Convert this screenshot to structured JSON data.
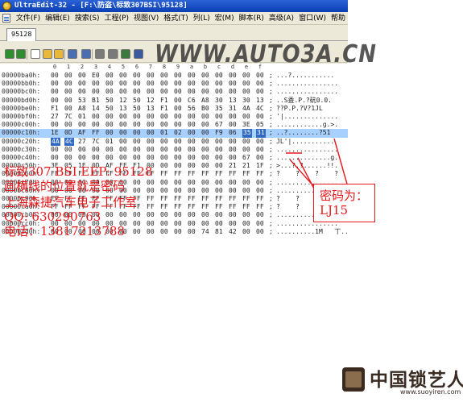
{
  "window": {
    "title": "UltraEdit-32 - [F:\\防盗\\标致307BSI\\95128]",
    "menu": [
      "文件(F)",
      "编辑(E)",
      "搜索(S)",
      "工程(P)",
      "视图(V)",
      "格式(T)",
      "列(L)",
      "宏(M)",
      "脚本(R)",
      "高级(A)",
      "窗口(W)",
      "帮助"
    ],
    "tab": "95128",
    "toolbar_icons": [
      "arrow-left-icon",
      "arrow-right-icon",
      "new-file-icon",
      "open-folder-icon",
      "open-folder-icon",
      "save-icon",
      "save-all-icon",
      "print-icon",
      "print-preview-icon",
      "hex-view-icon",
      "spell-check-icon"
    ]
  },
  "watermark": "WWW.AUTO3A.CN",
  "editor": {
    "ruler": [
      "0",
      "1",
      "2",
      "3",
      "4",
      "5",
      "6",
      "7",
      "8",
      "9",
      "a",
      "b",
      "c",
      "d",
      "e",
      "f"
    ],
    "rows": [
      {
        "addr": "00000ba0h:",
        "hex": [
          "00",
          "00",
          "00",
          "E0",
          "00",
          "00",
          "00",
          "00",
          "00",
          "00",
          "00",
          "00",
          "00",
          "00",
          "00",
          "00"
        ],
        "ascii": "...?..........."
      },
      {
        "addr": "00000bb0h:",
        "hex": [
          "00",
          "00",
          "00",
          "00",
          "00",
          "00",
          "00",
          "00",
          "00",
          "00",
          "00",
          "00",
          "00",
          "00",
          "00",
          "00"
        ],
        "ascii": "................"
      },
      {
        "addr": "00000bc0h:",
        "hex": [
          "00",
          "00",
          "00",
          "00",
          "00",
          "00",
          "00",
          "00",
          "00",
          "00",
          "00",
          "00",
          "00",
          "00",
          "00",
          "00"
        ],
        "ascii": "................"
      },
      {
        "addr": "00000bd0h:",
        "hex": [
          "00",
          "00",
          "53",
          "B1",
          "50",
          "12",
          "50",
          "12",
          "F1",
          "00",
          "C6",
          "A8",
          "30",
          "13",
          "30",
          "13"
        ],
        "ascii": "..S盉.P.?砊0.0."
      },
      {
        "addr": "00000be0h:",
        "hex": [
          "F1",
          "00",
          "A8",
          "14",
          "50",
          "13",
          "50",
          "13",
          "F1",
          "00",
          "56",
          "B0",
          "35",
          "31",
          "4A",
          "4C"
        ],
        "ascii": "??P.P.?V?1JL"
      },
      {
        "addr": "00000bf0h:",
        "hex": [
          "27",
          "7C",
          "01",
          "00",
          "00",
          "00",
          "00",
          "00",
          "00",
          "00",
          "00",
          "00",
          "00",
          "00",
          "00",
          "00"
        ],
        "ascii": "'|.............."
      },
      {
        "addr": "00000c00h:",
        "hex": [
          "00",
          "00",
          "00",
          "00",
          "00",
          "00",
          "00",
          "00",
          "00",
          "00",
          "00",
          "00",
          "67",
          "00",
          "3E",
          "05"
        ],
        "ascii": "............g.>."
      },
      {
        "addr": "00000c10h:",
        "hex": [
          "1E",
          "0D",
          "AF",
          "FF",
          "00",
          "00",
          "00",
          "00",
          "01",
          "02",
          "00",
          "00",
          "F9",
          "06",
          "35",
          "31"
        ],
        "ascii": "..?........?51",
        "selected": true,
        "hl": [
          14,
          15
        ]
      },
      {
        "addr": "00000c20h:",
        "hex": [
          "4A",
          "4C",
          "27",
          "7C",
          "01",
          "00",
          "00",
          "00",
          "00",
          "00",
          "00",
          "00",
          "00",
          "00",
          "00",
          "00"
        ],
        "ascii": "JL'|...........",
        "hl": [
          0,
          1
        ]
      },
      {
        "addr": "00000c30h:",
        "hex": [
          "00",
          "00",
          "00",
          "00",
          "00",
          "00",
          "00",
          "00",
          "00",
          "00",
          "00",
          "00",
          "00",
          "00",
          "00",
          "00"
        ],
        "ascii": "................"
      },
      {
        "addr": "00000c40h:",
        "hex": [
          "00",
          "00",
          "00",
          "00",
          "00",
          "00",
          "00",
          "00",
          "00",
          "00",
          "00",
          "00",
          "00",
          "00",
          "67",
          "00"
        ],
        "ascii": "..............g."
      },
      {
        "addr": "00000c50h:",
        "hex": [
          "3E",
          "05",
          "1E",
          "0D",
          "AF",
          "FF",
          "F1",
          "00",
          "00",
          "00",
          "00",
          "00",
          "00",
          "21",
          "21",
          "1F"
        ],
        "ascii": ">...?.?......!!."
      },
      {
        "addr": "00000c60h:",
        "hex": [
          "FF",
          "FF",
          "FF",
          "FF",
          "FF",
          "FF",
          "FF",
          "FF",
          "FF",
          "FF",
          "FF",
          "FF",
          "FF",
          "FF",
          "FF",
          "FF"
        ],
        "ascii": "?    ?    ?    ?"
      },
      {
        "addr": "00000c70h:",
        "hex": [
          "00",
          "00",
          "00",
          "00",
          "00",
          "00",
          "00",
          "00",
          "00",
          "00",
          "00",
          "00",
          "00",
          "00",
          "00",
          "00"
        ],
        "ascii": "................"
      },
      {
        "addr": "00000c80h:",
        "hex": [
          "00",
          "00",
          "00",
          "00",
          "00",
          "00",
          "00",
          "00",
          "00",
          "00",
          "00",
          "00",
          "00",
          "00",
          "00",
          "00"
        ],
        "ascii": "................"
      },
      {
        "addr": "00000c90h:",
        "hex": [
          "FF",
          "FF",
          "FF",
          "FF",
          "FF",
          "FF",
          "FF",
          "FF",
          "FF",
          "FF",
          "FF",
          "FF",
          "FF",
          "FF",
          "FF",
          "FF"
        ],
        "ascii": "?    ?    ?    ?"
      },
      {
        "addr": "00000ca0h:",
        "hex": [
          "FF",
          "FF",
          "FF",
          "FF",
          "FF",
          "FF",
          "FF",
          "FF",
          "FF",
          "FF",
          "FF",
          "FF",
          "FF",
          "FF",
          "FF",
          "FF"
        ],
        "ascii": "?    ?    ?    ?"
      },
      {
        "addr": "00000cb0h:",
        "hex": [
          "00",
          "00",
          "00",
          "00",
          "00",
          "00",
          "00",
          "00",
          "00",
          "00",
          "00",
          "00",
          "00",
          "00",
          "00",
          "00"
        ],
        "ascii": "................"
      },
      {
        "addr": "00000cc0h:",
        "hex": [
          "00",
          "00",
          "00",
          "00",
          "00",
          "00",
          "00",
          "00",
          "00",
          "00",
          "00",
          "00",
          "00",
          "00",
          "00",
          "00"
        ],
        "ascii": "................"
      },
      {
        "addr": "00000cd0h:",
        "hex": [
          "00",
          "00",
          "00",
          "00",
          "00",
          "00",
          "00",
          "00",
          "00",
          "00",
          "00",
          "74",
          "81",
          "42",
          "00",
          "00"
        ],
        "ascii": "..........1M   丅......"
      }
    ]
  },
  "notes": [
    "标致307 BSI     EEP:    95128",
    "画横线的位置就是密码",
    "上海森捷汽车电子工作室",
    "QQ: 630290763",
    "电话：13817213788"
  ],
  "callout": {
    "line1": "密码为：",
    "line2": "LJ15"
  },
  "logo": {
    "text": "中国锁艺人",
    "url": "www.suoyiren.com"
  },
  "colors": {
    "annotation_red": "#e8171a",
    "selection_blue": "#316ac5",
    "titlebar_blue": "#0a3fb4"
  }
}
